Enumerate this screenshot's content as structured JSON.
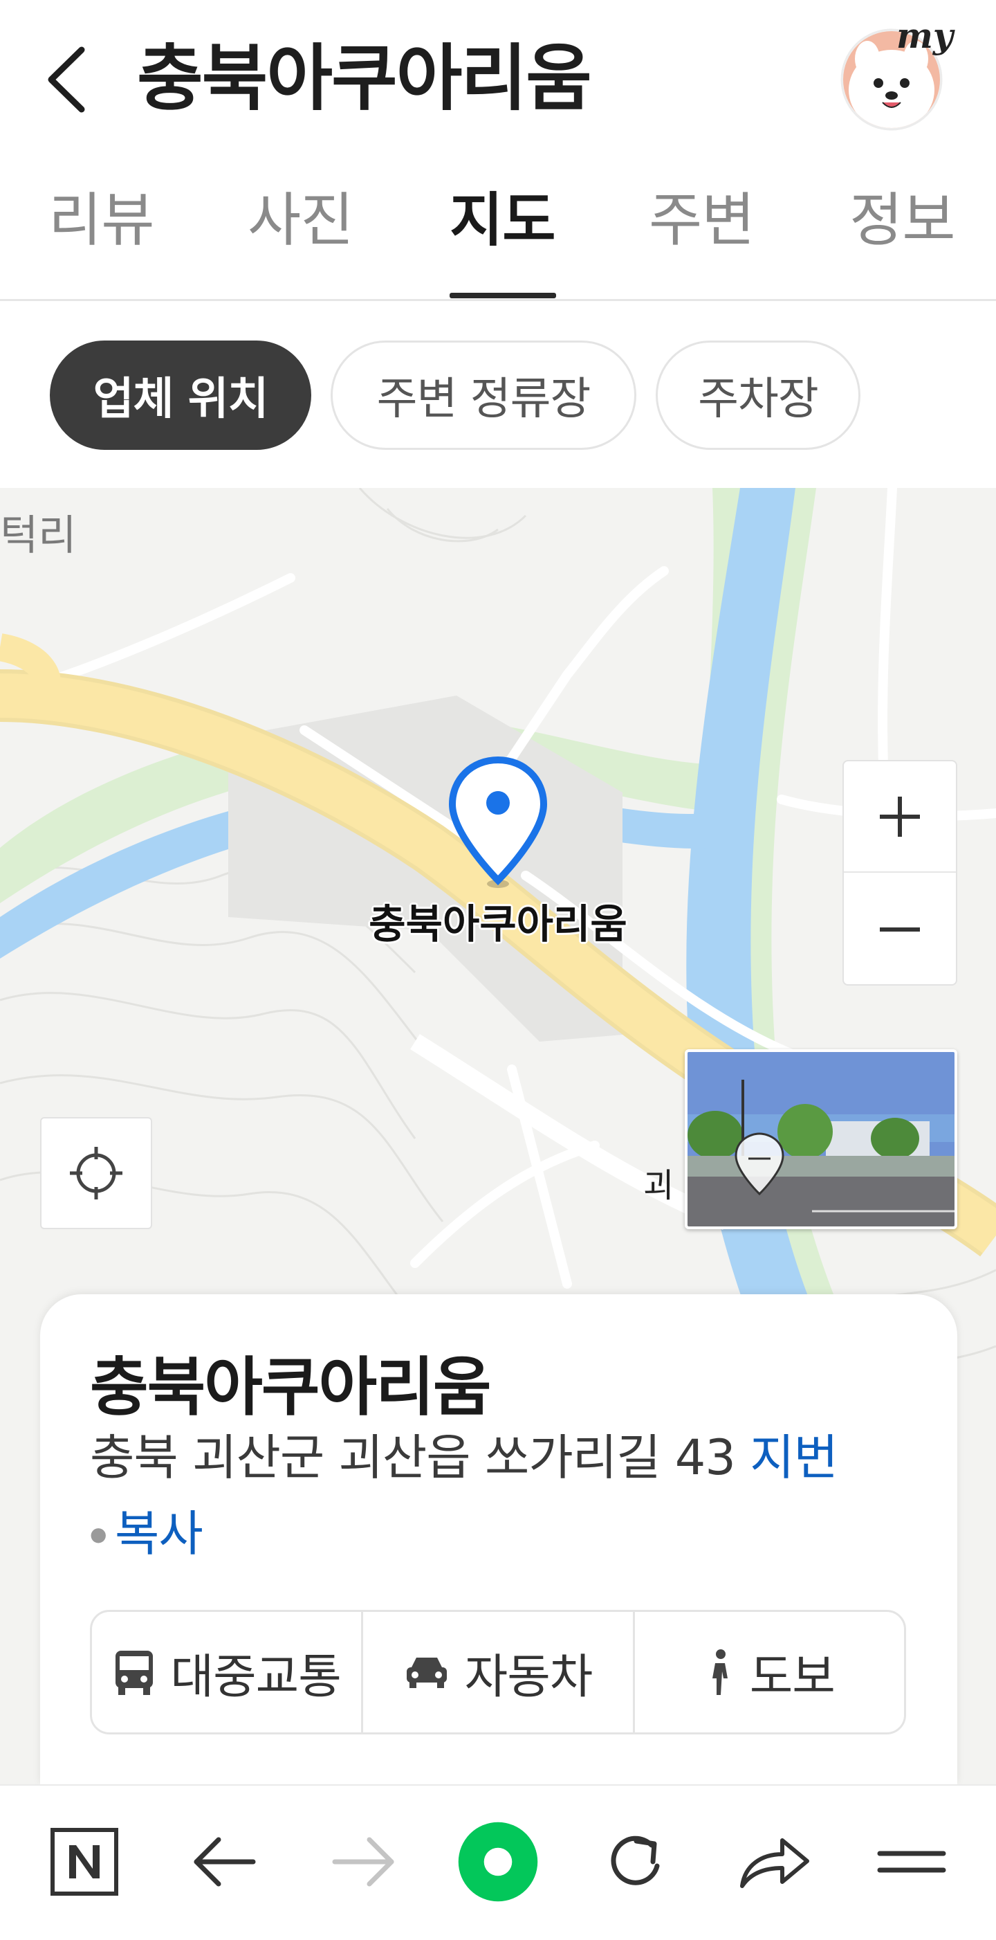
{
  "header": {
    "title": "충북아쿠아리움",
    "avatar_badge": "my"
  },
  "tabs": [
    "리뷰",
    "사진",
    "지도",
    "주변",
    "정보"
  ],
  "active_tab": "지도",
  "chips": [
    "업체 위치",
    "주변 정류장",
    "주차장"
  ],
  "active_chip": "업체 위치",
  "map": {
    "marker_label": "충북아쿠아리움",
    "village_label": "턱리",
    "town_label": "괴",
    "zoom_in": "+",
    "zoom_out": "−"
  },
  "card": {
    "title": "충북아쿠아리움",
    "address": "충북 괴산군 괴산읍 쏘가리길 43",
    "jibun_link": "지번",
    "copy_link": "복사",
    "routes": [
      "대중교통",
      "자동차",
      "도보"
    ]
  },
  "colors": {
    "accent_blue": "#1a73e8",
    "link_blue": "#0d5fbf",
    "naver_green": "#03c75a",
    "river": "#a9d3f5",
    "road": "#fbe7a6"
  }
}
